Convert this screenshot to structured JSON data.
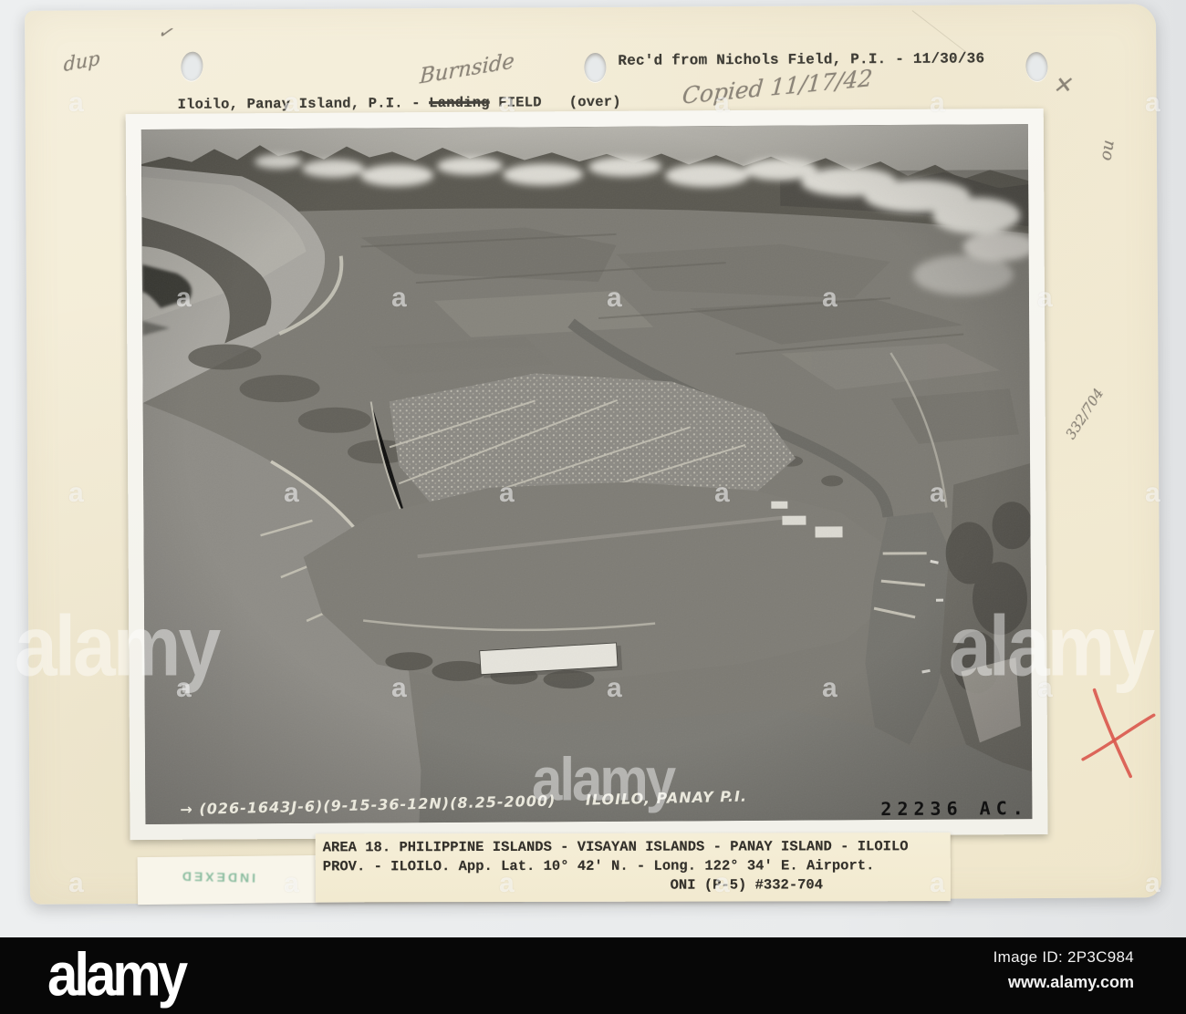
{
  "header": {
    "dup_note": "dup",
    "checkmark": "✓",
    "title_prefix": "Iloilo, Panay Island, P.I. - ",
    "struck_word": "Landing",
    "title_suffix": " FIELD",
    "over_note": "(over)",
    "burnside_note": "Burnside",
    "received_line": "Rec'd from Nichols Field, P.I. - 11/30/36",
    "copied_note": "Copied  11/17/42",
    "pencil_x": "✕"
  },
  "margin_notes": {
    "no_note": "no",
    "file_note": "332/704"
  },
  "photo": {
    "caption_arrow": "→",
    "caption_codes": "(026-1643J-6)(9-15-36-12N)(8.25-2000)",
    "caption_location": "ILOILO, PANAY P.I.",
    "stamp_number": "22236 AC."
  },
  "label": {
    "line1": "AREA 18.  PHILIPPINE ISLANDS - VISAYAN ISLANDS - PANAY ISLAND - ILOILO",
    "line2": "PROV. - ILOILO.  App. Lat. 10° 42' N. - Long. 122° 34' E.  Airport.",
    "line3": "ONI (P-5)  #332-704"
  },
  "stamps": {
    "green_stamp": "INDEXED"
  },
  "watermark": {
    "brand": "alamy",
    "letter": "a",
    "image_id": "Image ID: 2P3C984",
    "site": "www.alamy.com"
  },
  "colors": {
    "card": "#f3ecd6",
    "photo_gray": "#7c7a73",
    "crayon_red": "#d9564c",
    "stamp_green": "#3f9e77",
    "bar_black": "#070707"
  }
}
